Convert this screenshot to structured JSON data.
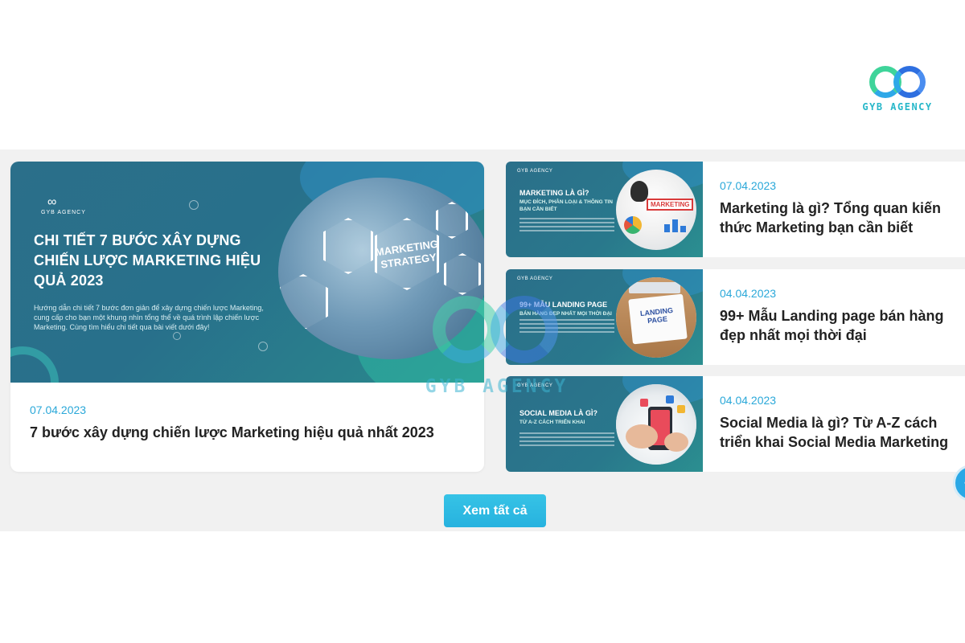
{
  "brand": {
    "logo_text": "GYB AGENCY",
    "watermark_text": "GYB AGENCY",
    "mini_logo_text": "GYB AGENCY"
  },
  "featured": {
    "image_title": "CHI TIẾT 7 BƯỚC XÂY DỰNG CHIẾN LƯỢC MARKETING HIỆU QUẢ 2023",
    "image_description": "Hướng dẫn chi tiết 7 bước đơn giản để xây dựng chiến lược Marketing, cung cấp cho bạn một khung nhìn tổng thể về quá trình lập chiến lược Marketing. Cùng tìm hiểu chi tiết qua bài viết dưới đây!",
    "image_badge": "MARKETING STRATEGY",
    "date": "07.04.2023",
    "title": "7 bước xây dựng chiến lược Marketing hiệu quả nhất 2023"
  },
  "posts": [
    {
      "image_title": "MARKETING LÀ GÌ?",
      "image_subtitle": "MỤC ĐÍCH, PHÂN LOẠI & THÔNG TIN BẠN CẦN BIẾT",
      "image_badge": "MARKETING",
      "date": "07.04.2023",
      "title": "Marketing là gì? Tổng quan kiến thức Marketing bạn cần biết"
    },
    {
      "image_title": "99+ MẪU LANDING PAGE",
      "image_subtitle": "BÁN HÀNG ĐẸP NHẤT MỌI THỜI ĐẠI",
      "image_badge": "LANDING PAGE",
      "date": "04.04.2023",
      "title": "99+ Mẫu Landing page bán hàng đẹp nhất mọi thời đại"
    },
    {
      "image_title": "SOCIAL MEDIA LÀ GÌ?",
      "image_subtitle": "TỪ A-Z CÁCH TRIỂN KHAI",
      "date": "04.04.2023",
      "title": "Social Media là gì? Từ A-Z cách triển khai Social Media Marketing"
    }
  ],
  "actions": {
    "see_all": "Xem tất cả"
  },
  "colors": {
    "accent": "#2aa8d9",
    "card_bg": "#28708b",
    "band": "#f1f1f1"
  },
  "icons": {
    "logo": "gyb-infinity-logo-icon",
    "float": "chat-bubble-icon"
  }
}
